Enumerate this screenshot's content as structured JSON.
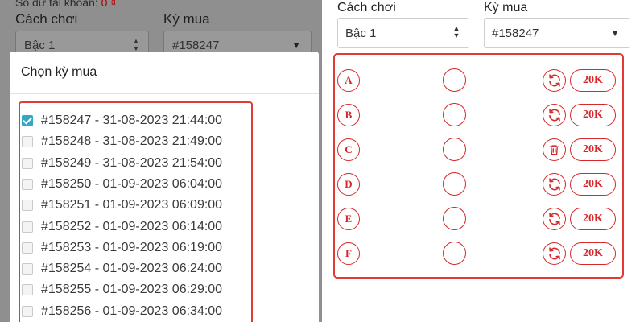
{
  "background": {
    "balance_label": "Số dư tài khoản: ",
    "balance_value": "0 ₫",
    "mode_label": "Cách chơi",
    "mode_value": "Bậc 1",
    "period_label": "Kỳ mua",
    "period_value": "#158247"
  },
  "modal": {
    "title": "Chọn kỳ mua",
    "periods": [
      {
        "label": "#158247 - 31-08-2023 21:44:00",
        "checked": true
      },
      {
        "label": "#158248 - 31-08-2023 21:49:00",
        "checked": false
      },
      {
        "label": "#158249 - 31-08-2023 21:54:00",
        "checked": false
      },
      {
        "label": "#158250 - 01-09-2023 06:04:00",
        "checked": false
      },
      {
        "label": "#158251 - 01-09-2023 06:09:00",
        "checked": false
      },
      {
        "label": "#158252 - 01-09-2023 06:14:00",
        "checked": false
      },
      {
        "label": "#158253 - 01-09-2023 06:19:00",
        "checked": false
      },
      {
        "label": "#158254 - 01-09-2023 06:24:00",
        "checked": false
      },
      {
        "label": "#158255 - 01-09-2023 06:29:00",
        "checked": false
      },
      {
        "label": "#158256 - 01-09-2023 06:34:00",
        "checked": false
      }
    ]
  },
  "form": {
    "mode_label": "Cách chơi",
    "mode_value": "Bậc 1",
    "period_label": "Kỳ mua",
    "period_value": "#158247"
  },
  "tickets": [
    {
      "letter": "A",
      "action_icon": "refresh-icon",
      "amount": "20K"
    },
    {
      "letter": "B",
      "action_icon": "refresh-icon",
      "amount": "20K"
    },
    {
      "letter": "C",
      "action_icon": "trash-icon",
      "amount": "20K"
    },
    {
      "letter": "D",
      "action_icon": "refresh-icon",
      "amount": "20K"
    },
    {
      "letter": "E",
      "action_icon": "refresh-icon",
      "amount": "20K"
    },
    {
      "letter": "F",
      "action_icon": "refresh-icon",
      "amount": "20K"
    }
  ],
  "colors": {
    "accent_red": "#d6282b",
    "highlight_border": "#e53935",
    "checkbox_checked": "#35a8c8",
    "overlay": "#8f8f8f"
  }
}
